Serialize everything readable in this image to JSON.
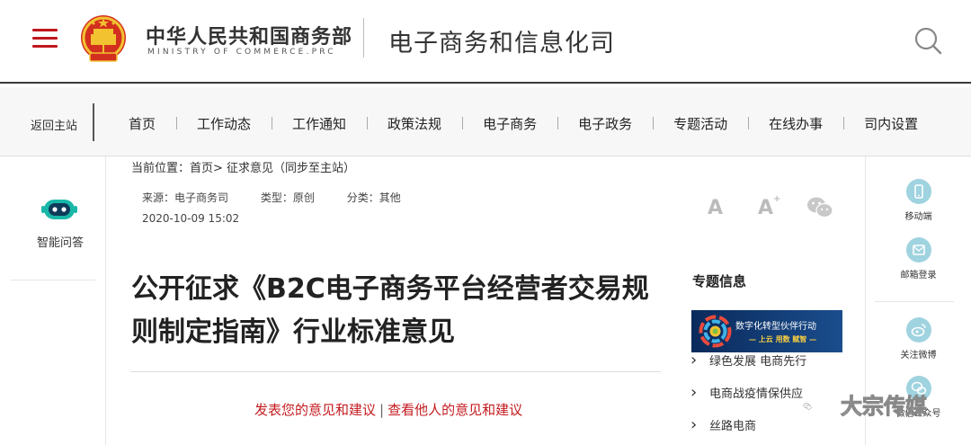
{
  "header": {
    "ministry_cn": "中华人民共和国商务部",
    "ministry_en": "MINISTRY OF COMMERCE.PRC",
    "department": "电子商务和信息化司",
    "accent_color": "#c0171d"
  },
  "nav": {
    "back_home": "返回主站",
    "items": [
      "首页",
      "工作动态",
      "工作通知",
      "政策法规",
      "电子商务",
      "电子政务",
      "专题活动",
      "在线办事",
      "司内设置"
    ]
  },
  "left_sidebar": {
    "smart_qa": "智能问答"
  },
  "article": {
    "breadcrumb_prefix": "当前位置：",
    "breadcrumb_home": "首页",
    "breadcrumb_rest": "> 征求意见（同步至主站）",
    "source": "来源：电子商务司",
    "type": "类型：原创",
    "category": "分类：其他",
    "date": "2020-10-09 15:02",
    "title": "公开征求《B2C电子商务平台经营者交易规则制定指南》行业标准意见",
    "link_submit": "发表您的意见和建议",
    "link_separator": "|",
    "link_view": "查看他人的意见和建议"
  },
  "font_controls": {
    "bigger": "A",
    "smaller": "A",
    "smaller_mark": "+"
  },
  "topics": {
    "title": "专题信息",
    "banner_line1": "数字化转型伙伴行动",
    "banner_line2": "— 上云 用数 赋智 —",
    "items": [
      "绿色发展 电商先行",
      "电商战疫情保供应",
      "丝路电商"
    ]
  },
  "right_sidebar": {
    "mobile": "移动端",
    "mail_login": "邮箱登录",
    "weibo": "关注微博",
    "wechat": "微信公众号"
  },
  "watermark": {
    "text": "大宗传媒"
  }
}
